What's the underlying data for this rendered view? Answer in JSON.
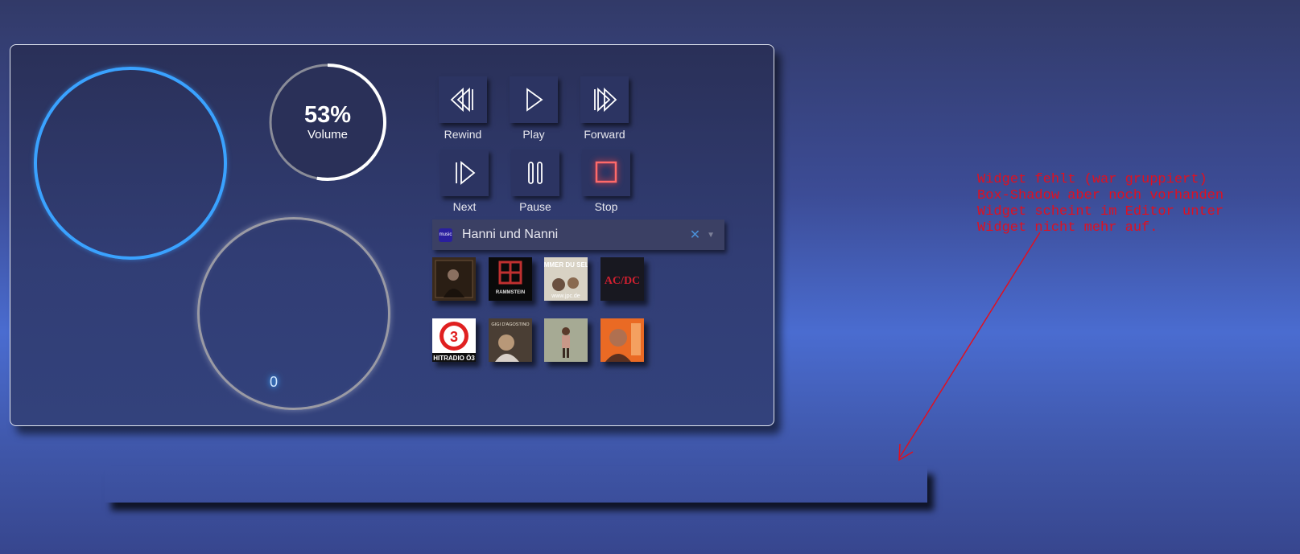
{
  "gauge": {
    "percent": "53%",
    "label": "Volume",
    "fraction": 0.53
  },
  "knob": {
    "value": "0"
  },
  "controls": [
    {
      "label": "Rewind",
      "icon": "rewind-icon"
    },
    {
      "label": "Play",
      "icon": "play-icon"
    },
    {
      "label": "Forward",
      "icon": "forward-icon"
    },
    {
      "label": "Next",
      "icon": "next-icon"
    },
    {
      "label": "Pause",
      "icon": "pause-icon"
    },
    {
      "label": "Stop",
      "icon": "stop-icon"
    }
  ],
  "playlist_select": {
    "value": "Hanni und Nanni",
    "icon": "amazon-music-icon",
    "icon_text": "music"
  },
  "albums": {
    "cover_texts": [
      "RAMMSTEIN",
      "SEI IMMER DU SELBST",
      "www.jpc.de",
      "AC/DC",
      "HITRADIO Ö3",
      "GIGI D'AGOSTINO"
    ]
  },
  "annotation": {
    "lines": [
      "Widget fehlt (war gruppiert)",
      "Box-Shadow aber noch vorhanden",
      "Widget scheint im Editor unter",
      "Widget nicht mehr auf."
    ]
  },
  "colors": {
    "accent_blue": "#3aa2ff",
    "stop_red": "#ff5a5a",
    "annotation_red": "#e01020"
  }
}
